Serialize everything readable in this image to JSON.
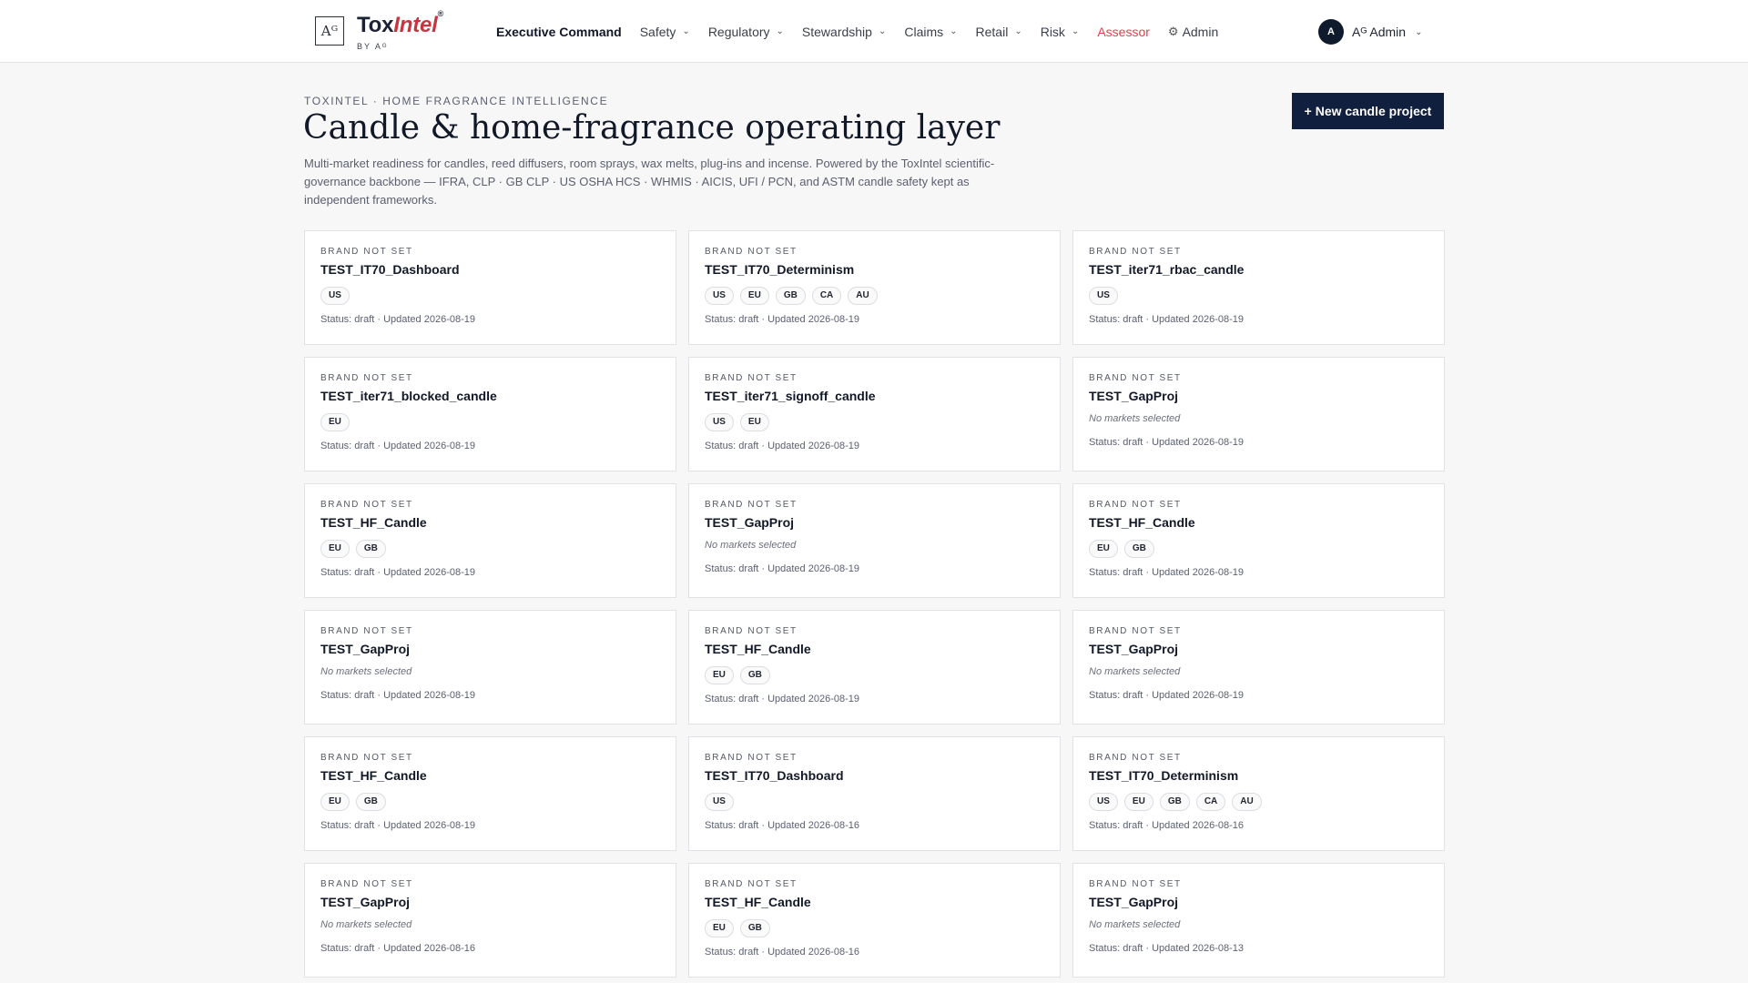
{
  "header": {
    "logo_mark": "Aᴳ",
    "logo_tox": "Tox",
    "logo_intel": "Intel",
    "logo_reg": "®",
    "logo_by": "BY Aᴳ",
    "nav": [
      {
        "label": "Executive Command",
        "dropdown": false,
        "style": "active"
      },
      {
        "label": "Safety",
        "dropdown": true,
        "style": ""
      },
      {
        "label": "Regulatory",
        "dropdown": true,
        "style": ""
      },
      {
        "label": "Stewardship",
        "dropdown": true,
        "style": ""
      },
      {
        "label": "Claims",
        "dropdown": true,
        "style": ""
      },
      {
        "label": "Retail",
        "dropdown": true,
        "style": ""
      },
      {
        "label": "Risk",
        "dropdown": true,
        "style": ""
      },
      {
        "label": "Assessor",
        "dropdown": false,
        "style": "accent"
      },
      {
        "label": "Admin",
        "dropdown": false,
        "style": "",
        "icon": "gear-icon"
      }
    ],
    "user": {
      "initial": "A",
      "name": "Aᴳ Admin"
    }
  },
  "page": {
    "eyebrow": "TOXINTEL · HOME FRAGRANCE INTELLIGENCE",
    "title": "Candle & home-fragrance operating layer",
    "description": "Multi-market readiness for candles, reed diffusers, room sprays, wax melts, plug-ins and incense. Powered by the ToxIntel scientific-governance backbone — IFRA, CLP · GB CLP · US OSHA HCS · WHMIS · AICIS, UFI / PCN, and ASTM candle safety kept as independent frameworks.",
    "new_button": "+ New candle project",
    "no_markets_text": "No markets selected"
  },
  "projects": [
    {
      "brand": "BRAND NOT SET",
      "name": "TEST_IT70_Dashboard",
      "markets": [
        "US"
      ],
      "status": "Status: draft · Updated 2026-08-19"
    },
    {
      "brand": "BRAND NOT SET",
      "name": "TEST_IT70_Determinism",
      "markets": [
        "US",
        "EU",
        "GB",
        "CA",
        "AU"
      ],
      "status": "Status: draft · Updated 2026-08-19"
    },
    {
      "brand": "BRAND NOT SET",
      "name": "TEST_iter71_rbac_candle",
      "markets": [
        "US"
      ],
      "status": "Status: draft · Updated 2026-08-19"
    },
    {
      "brand": "BRAND NOT SET",
      "name": "TEST_iter71_blocked_candle",
      "markets": [
        "EU"
      ],
      "status": "Status: draft · Updated 2026-08-19"
    },
    {
      "brand": "BRAND NOT SET",
      "name": "TEST_iter71_signoff_candle",
      "markets": [
        "US",
        "EU"
      ],
      "status": "Status: draft · Updated 2026-08-19"
    },
    {
      "brand": "BRAND NOT SET",
      "name": "TEST_GapProj",
      "markets": [],
      "status": "Status: draft · Updated 2026-08-19"
    },
    {
      "brand": "BRAND NOT SET",
      "name": "TEST_HF_Candle",
      "markets": [
        "EU",
        "GB"
      ],
      "status": "Status: draft · Updated 2026-08-19"
    },
    {
      "brand": "BRAND NOT SET",
      "name": "TEST_GapProj",
      "markets": [],
      "status": "Status: draft · Updated 2026-08-19"
    },
    {
      "brand": "BRAND NOT SET",
      "name": "TEST_HF_Candle",
      "markets": [
        "EU",
        "GB"
      ],
      "status": "Status: draft · Updated 2026-08-19"
    },
    {
      "brand": "BRAND NOT SET",
      "name": "TEST_GapProj",
      "markets": [],
      "status": "Status: draft · Updated 2026-08-19"
    },
    {
      "brand": "BRAND NOT SET",
      "name": "TEST_HF_Candle",
      "markets": [
        "EU",
        "GB"
      ],
      "status": "Status: draft · Updated 2026-08-19"
    },
    {
      "brand": "BRAND NOT SET",
      "name": "TEST_GapProj",
      "markets": [],
      "status": "Status: draft · Updated 2026-08-19"
    },
    {
      "brand": "BRAND NOT SET",
      "name": "TEST_HF_Candle",
      "markets": [
        "EU",
        "GB"
      ],
      "status": "Status: draft · Updated 2026-08-19"
    },
    {
      "brand": "BRAND NOT SET",
      "name": "TEST_IT70_Dashboard",
      "markets": [
        "US"
      ],
      "status": "Status: draft · Updated 2026-08-16"
    },
    {
      "brand": "BRAND NOT SET",
      "name": "TEST_IT70_Determinism",
      "markets": [
        "US",
        "EU",
        "GB",
        "CA",
        "AU"
      ],
      "status": "Status: draft · Updated 2026-08-16"
    },
    {
      "brand": "BRAND NOT SET",
      "name": "TEST_GapProj",
      "markets": [],
      "status": "Status: draft · Updated 2026-08-16"
    },
    {
      "brand": "BRAND NOT SET",
      "name": "TEST_HF_Candle",
      "markets": [
        "EU",
        "GB"
      ],
      "status": "Status: draft · Updated 2026-08-16"
    },
    {
      "brand": "BRAND NOT SET",
      "name": "TEST_GapProj",
      "markets": [],
      "status": "Status: draft · Updated 2026-08-13"
    }
  ]
}
